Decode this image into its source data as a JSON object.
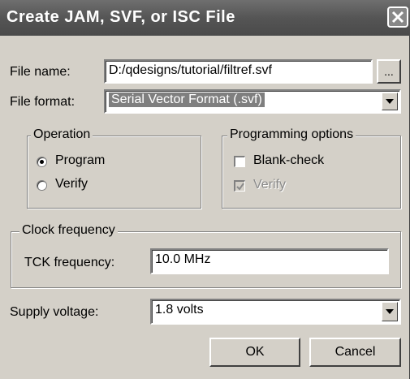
{
  "window": {
    "title": "Create JAM, SVF, or ISC File"
  },
  "file_name": {
    "label": "File name:",
    "value": "D:/qdesigns/tutorial/filtref.svf",
    "browse_label": "..."
  },
  "file_format": {
    "label": "File format:",
    "value": "Serial Vector Format (.svf)"
  },
  "operation": {
    "legend": "Operation",
    "options": [
      {
        "label": "Program",
        "selected": true
      },
      {
        "label": "Verify",
        "selected": false
      }
    ]
  },
  "programming_options": {
    "legend": "Programming options",
    "blank_check": {
      "label": "Blank-check",
      "checked": false,
      "enabled": true
    },
    "verify": {
      "label": "Verify",
      "checked": true,
      "enabled": false
    }
  },
  "clock": {
    "legend": "Clock frequency",
    "tck_label": "TCK frequency:",
    "tck_value": "10.0 MHz"
  },
  "supply_voltage": {
    "label": "Supply voltage:",
    "value": "1.8 volts"
  },
  "buttons": {
    "ok": "OK",
    "cancel": "Cancel"
  }
}
